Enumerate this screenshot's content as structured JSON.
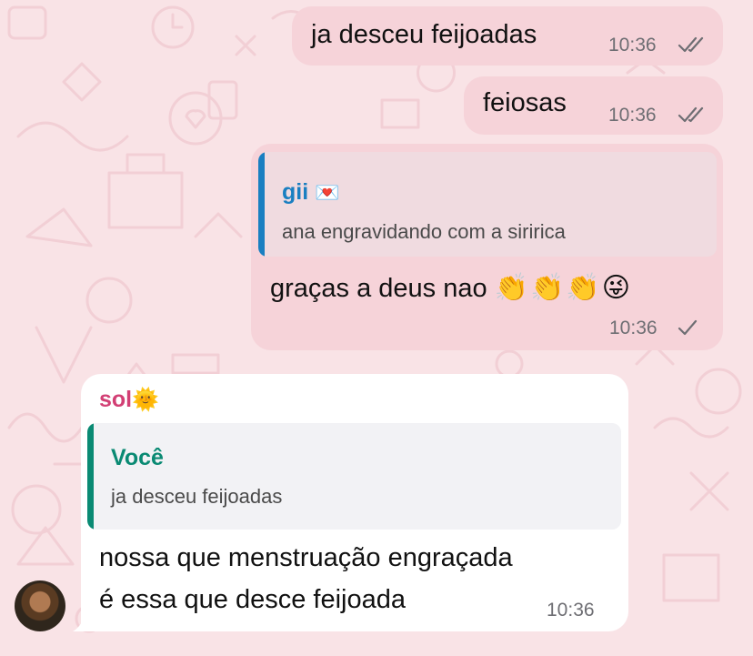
{
  "colors": {
    "background": "#f9e3e6",
    "outgoing_bubble": "#f6d3d9",
    "incoming_bubble": "#ffffff",
    "quote_blue": "#1a7fc1",
    "quote_green": "#0a8a73",
    "sender_pink": "#d23f74"
  },
  "messages": [
    {
      "text": "ja desceu feijoadas",
      "time": "10:36",
      "status_icon": "double-check-icon"
    },
    {
      "text": "feiosas",
      "time": "10:36",
      "status_icon": "double-check-icon"
    },
    {
      "quote": {
        "name": "gii",
        "name_emoji": "💌",
        "text": "ana engravidando com a siririca"
      },
      "text": "graças a deus nao",
      "emojis": "👏👏👏😜",
      "time": "10:36",
      "status_icon": "single-check-icon"
    },
    {
      "sender": "sol",
      "sender_emoji": "🌞",
      "quote": {
        "name": "Você",
        "text": "ja desceu feijoadas"
      },
      "text_line1": "nossa que menstruação engraçada",
      "text_line2": "é essa que desce feijoada",
      "time": "10:36"
    }
  ]
}
